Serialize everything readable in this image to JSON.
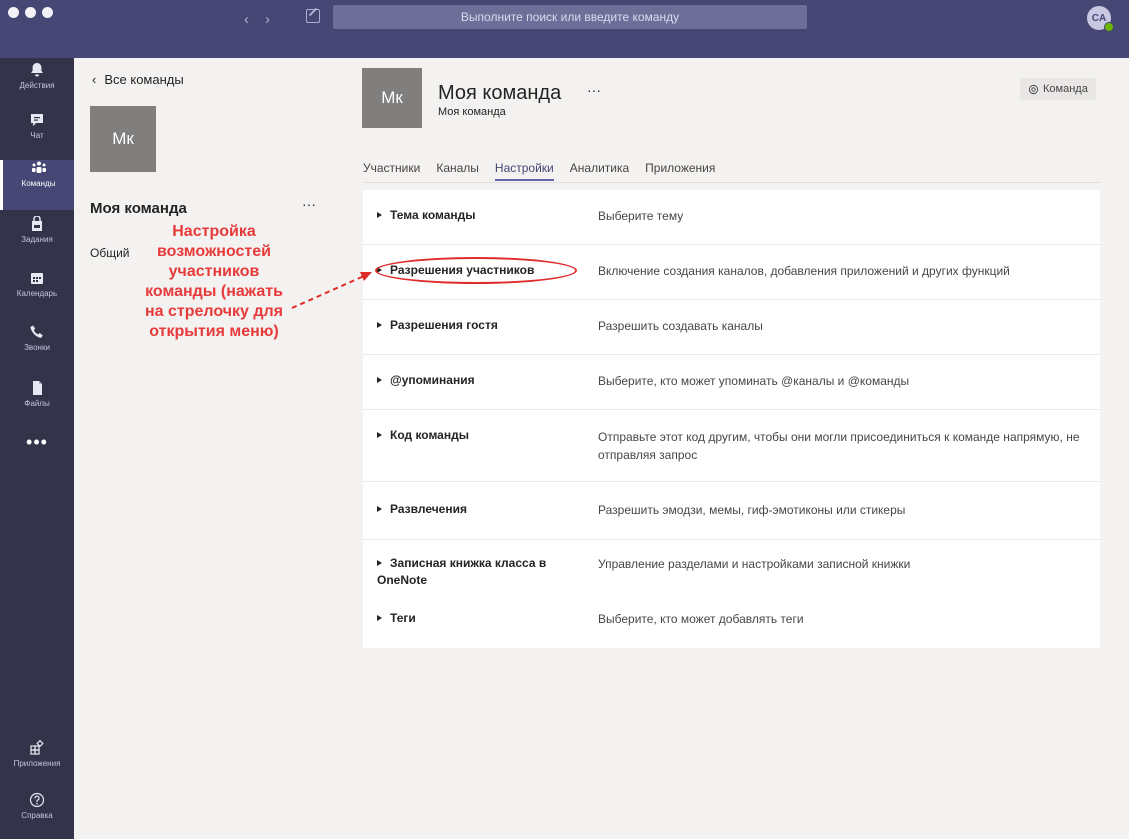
{
  "window": {
    "search_placeholder": "Выполните поиск или введите команду",
    "avatar_initials": "CA"
  },
  "rail": {
    "items": [
      {
        "label": "Действия",
        "icon": "bell-icon"
      },
      {
        "label": "Чат",
        "icon": "chat-icon"
      },
      {
        "label": "Команды",
        "icon": "teams-icon"
      },
      {
        "label": "Задания",
        "icon": "assignments-icon"
      },
      {
        "label": "Календарь",
        "icon": "calendar-icon"
      },
      {
        "label": "Звонки",
        "icon": "phone-icon"
      },
      {
        "label": "Файлы",
        "icon": "files-icon"
      }
    ],
    "more": "•••",
    "bottom": [
      {
        "label": "Приложения",
        "icon": "apps-icon"
      },
      {
        "label": "Справка",
        "icon": "help-icon"
      }
    ]
  },
  "teampane": {
    "back_label": "Все команды",
    "tile_initials": "Мк",
    "team_name": "Моя команда",
    "more": "···",
    "channel": "Общий"
  },
  "annotation": {
    "lines": [
      "Настройка",
      "возможностей",
      "участников",
      "команды (нажать",
      "на стрелочку для",
      "открытия меню)"
    ]
  },
  "main": {
    "tile_initials": "Мк",
    "title": "Моя команда",
    "more": "···",
    "subtitle": "Моя команда",
    "team_button": "Команда",
    "tabs": [
      "Участники",
      "Каналы",
      "Настройки",
      "Аналитика",
      "Приложения"
    ],
    "active_tab": "Настройки",
    "settings": [
      {
        "title": "Тема команды",
        "desc": "Выберите тему"
      },
      {
        "title": "Разрешения участников",
        "desc": "Включение создания каналов, добавления приложений и других функций"
      },
      {
        "title": "Разрешения гостя",
        "desc": "Разрешить создавать каналы"
      },
      {
        "title": "@упоминания",
        "desc": "Выберите, кто может упоминать @каналы и @команды"
      },
      {
        "title": "Код команды",
        "desc": "Отправьте этот код другим, чтобы они могли присоединиться к команде напрямую, не отправляя запрос"
      },
      {
        "title": "Развлечения",
        "desc": "Разрешить эмодзи, мемы, гиф-эмотиконы или стикеры"
      },
      {
        "title": "Записная книжка класса в OneNote",
        "desc": "Управление разделами и настройками записной книжки"
      },
      {
        "title": "Теги",
        "desc": "Выберите, кто может добавлять теги"
      }
    ]
  },
  "colors": {
    "titlebar": "#464775",
    "rail": "#33344a",
    "accent": "#6264a7",
    "annotation": "#e73a3a"
  }
}
